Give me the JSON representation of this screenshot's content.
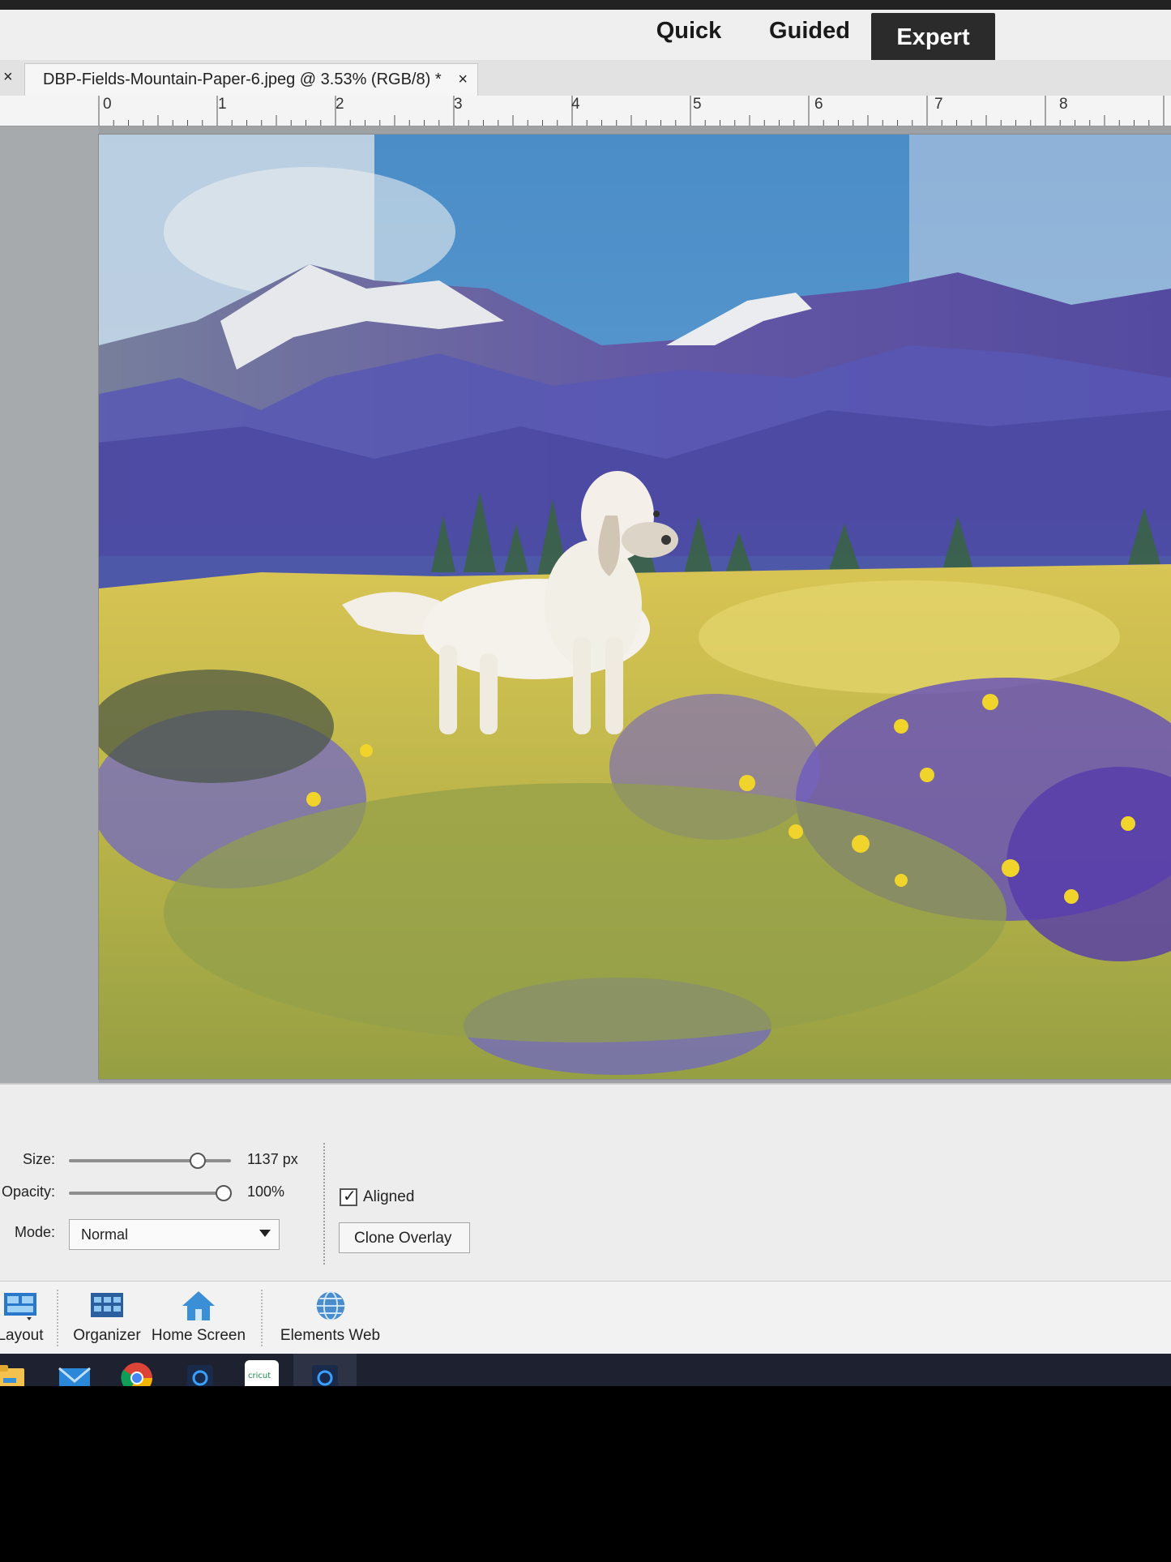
{
  "modes": {
    "quick": "Quick",
    "guided": "Guided",
    "expert": "Expert"
  },
  "document": {
    "tab_title": "DBP-Fields-Mountain-Paper-6.jpeg @ 3.53% (RGB/8) *",
    "close_glyph": "×"
  },
  "ruler": {
    "labels": [
      "0",
      "1",
      "2",
      "3",
      "4",
      "5",
      "6",
      "7",
      "8"
    ]
  },
  "tool_options": {
    "size_label": "Size:",
    "size_value": "1137 px",
    "size_fraction": 0.79,
    "opacity_label": "Opacity:",
    "opacity_value": "100%",
    "opacity_fraction": 1.0,
    "mode_label": "Mode:",
    "mode_value": "Normal",
    "aligned_label": "Aligned",
    "aligned_checked": true,
    "clone_overlay_label": "Clone Overlay"
  },
  "bottom_bar": {
    "items": [
      {
        "label": "Layout",
        "icon": "layout-icon"
      },
      {
        "label": "Organizer",
        "icon": "organizer-icon"
      },
      {
        "label": "Home Screen",
        "icon": "home-icon"
      },
      {
        "label": "Elements Web",
        "icon": "globe-icon"
      }
    ]
  },
  "taskbar": {
    "icons": [
      "file-explorer-icon",
      "mail-icon",
      "chrome-icon",
      "photoshop-elements-icon",
      "cricut-icon",
      "photoshop-elements-editor-icon"
    ],
    "cricut_text": "cricut"
  },
  "colors": {
    "accent_dark": "#2b2b2b",
    "taskbar": "#1e2230",
    "taskbar_highlight": "#76b9ed"
  }
}
